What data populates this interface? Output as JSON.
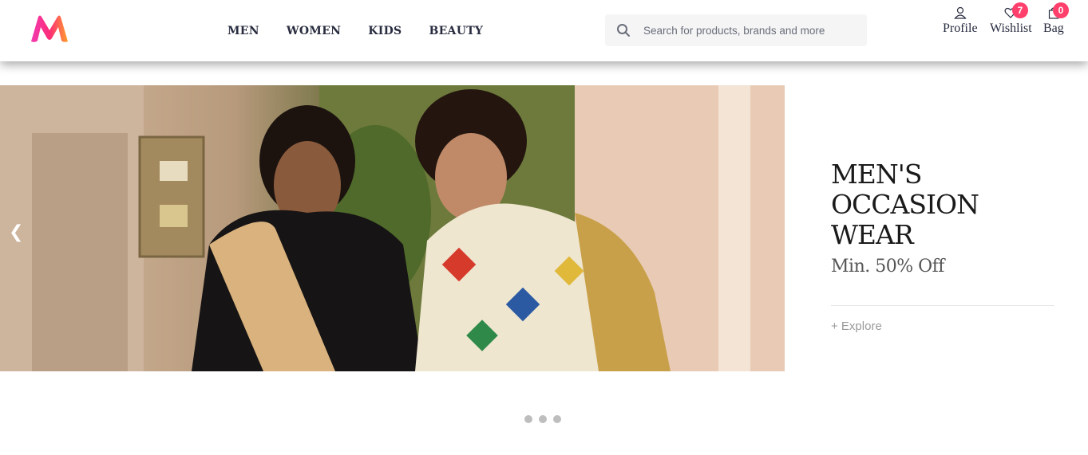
{
  "header": {
    "logo": "myntra-logo",
    "nav": [
      "MEN",
      "WOMEN",
      "KIDS",
      "BEAUTY"
    ],
    "search": {
      "placeholder": "Search for products, brands and more",
      "icon": "search-icon"
    },
    "actions": {
      "profile": {
        "label": "Profile",
        "icon": "user-icon"
      },
      "wishlist": {
        "label": "Wishlist",
        "icon": "heart-icon",
        "count": "7"
      },
      "bag": {
        "label": "Bag",
        "icon": "bag-icon",
        "count": "0"
      }
    },
    "colors": {
      "badge": "#ff3f6c",
      "text": "#282c3f",
      "search_bg": "#f5f5f6"
    }
  },
  "banner": {
    "prev_arrow": "❮",
    "title_line1": "MEN'S",
    "title_line2": "OCCASION WEAR",
    "subtitle": "Min. 50% Off",
    "cta": "+ Explore",
    "image": "two-men-in-ethnic-wear",
    "slides": 3
  }
}
